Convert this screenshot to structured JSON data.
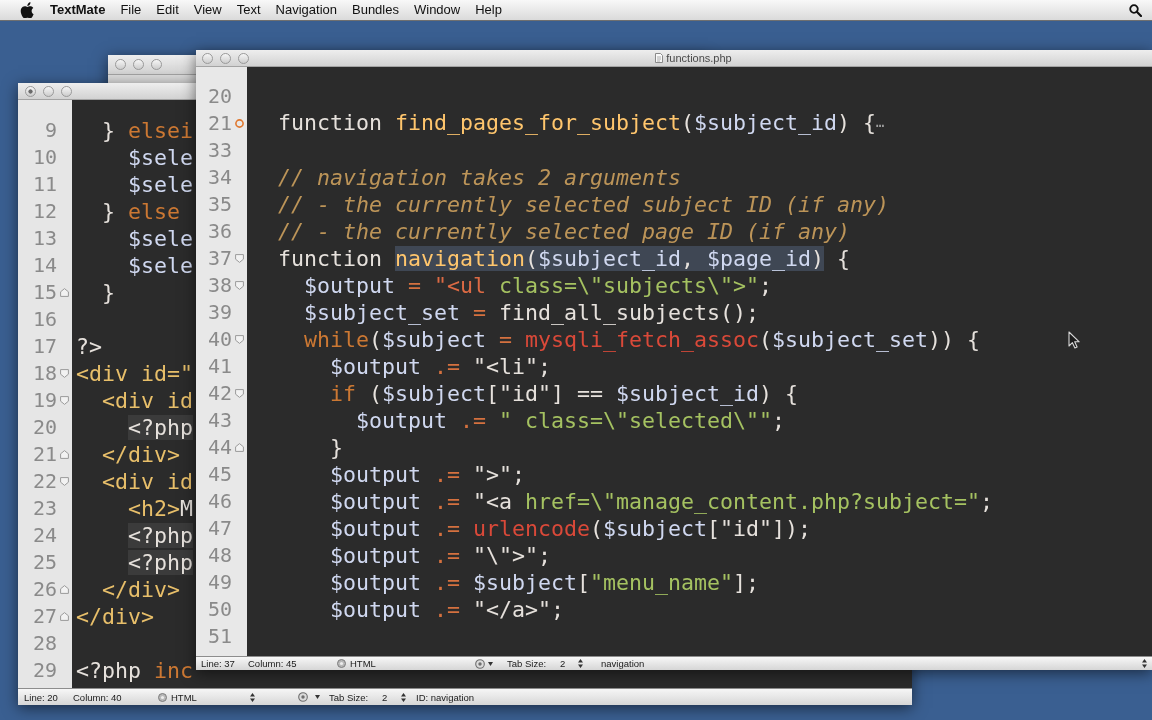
{
  "menu_bar": {
    "app_name": "TextMate",
    "menus": [
      "File",
      "Edit",
      "View",
      "Text",
      "Navigation",
      "Bundles",
      "Window",
      "Help"
    ]
  },
  "front_window": {
    "title": "functions.php",
    "unsaved": false,
    "lines": [
      {
        "number": "20",
        "kind": "code"
      },
      {
        "number": "21",
        "kind": "folded",
        "tokens": [
          {
            "kind": "plain",
            "text": "function "
          },
          {
            "kind": "entity",
            "text": "find_pages_for_subject"
          },
          {
            "kind": "plain",
            "text": "("
          },
          {
            "kind": "variable",
            "text": "$subject_id"
          },
          {
            "kind": "plain",
            "text": ") {"
          },
          {
            "kind": "fold-placeholder",
            "text": "⋯"
          }
        ]
      },
      {
        "number": "33",
        "kind": "code"
      },
      {
        "number": "34",
        "kind": "code",
        "tokens": [
          {
            "kind": "comment",
            "text": "// navigation takes 2 arguments"
          }
        ]
      },
      {
        "number": "35",
        "kind": "code",
        "tokens": [
          {
            "kind": "comment",
            "text": "// - the currently selected subject ID (if any)"
          }
        ]
      },
      {
        "number": "36",
        "kind": "code",
        "tokens": [
          {
            "kind": "comment",
            "text": "// - the currently selected page ID (if any)"
          }
        ]
      },
      {
        "number": "37",
        "kind": "fold-start",
        "tokens": [
          {
            "kind": "plain",
            "text": "function "
          },
          {
            "kind": "selection",
            "tokens": [
              {
                "kind": "entity",
                "text": "navigation"
              },
              {
                "kind": "plain",
                "text": "("
              },
              {
                "kind": "variable",
                "text": "$subject_id"
              },
              {
                "kind": "plain",
                "text": ", "
              },
              {
                "kind": "variable",
                "text": "$page_id"
              },
              {
                "kind": "plain",
                "text": ")"
              }
            ]
          },
          {
            "kind": "plain",
            "text": " {"
          }
        ],
        "children": [
          {
            "number": "38",
            "kind": "fold-start",
            "tokens": [
              {
                "kind": "variable",
                "text": "$output"
              },
              {
                "kind": "operator",
                "text": " = "
              },
              {
                "kind": "markup",
                "text": "\"<ul"
              },
              {
                "kind": "string",
                "text": " class=\\\"subjects\\\">\""
              },
              {
                "kind": "plain",
                "text": ";"
              }
            ]
          },
          {
            "number": "39",
            "kind": "code",
            "tokens": [
              {
                "kind": "variable",
                "text": "$subject_set"
              },
              {
                "kind": "operator",
                "text": " = "
              },
              {
                "kind": "plain",
                "text": "find_all_subjects();"
              }
            ]
          },
          {
            "number": "40",
            "kind": "fold-start",
            "tokens": [
              {
                "kind": "keyword",
                "text": "while"
              },
              {
                "kind": "plain",
                "text": "("
              },
              {
                "kind": "variable",
                "text": "$subject"
              },
              {
                "kind": "operator",
                "text": " = "
              },
              {
                "kind": "builtin",
                "text": "mysqli_fetch_assoc"
              },
              {
                "kind": "plain",
                "text": "("
              },
              {
                "kind": "variable",
                "text": "$subject_set"
              },
              {
                "kind": "plain",
                "text": ")) {"
              }
            ],
            "children": [
              {
                "number": "41",
                "kind": "code",
                "tokens": [
                  {
                    "kind": "variable",
                    "text": "$output"
                  },
                  {
                    "kind": "operator",
                    "text": " .= "
                  },
                  {
                    "kind": "plain",
                    "text": "\"<li\";"
                  }
                ]
              },
              {
                "number": "42",
                "kind": "fold-start",
                "tokens": [
                  {
                    "kind": "keyword",
                    "text": "if"
                  },
                  {
                    "kind": "plain",
                    "text": " ("
                  },
                  {
                    "kind": "variable",
                    "text": "$subject"
                  },
                  {
                    "kind": "plain",
                    "text": "[\"id\"] == "
                  },
                  {
                    "kind": "variable",
                    "text": "$subject_id"
                  },
                  {
                    "kind": "plain",
                    "text": ") {"
                  }
                ],
                "children": [
                  {
                    "number": "43",
                    "kind": "code",
                    "tokens": [
                      {
                        "kind": "variable",
                        "text": "$output"
                      },
                      {
                        "kind": "operator",
                        "text": " .= "
                      },
                      {
                        "kind": "string",
                        "text": "\" class=\\\"selected\\\"\""
                      },
                      {
                        "kind": "plain",
                        "text": ";"
                      }
                    ]
                  }
                ]
              },
              {
                "number": "44",
                "kind": "fold-end",
                "tokens": [
                  {
                    "kind": "plain",
                    "text": "}"
                  }
                ]
              },
              {
                "number": "45",
                "kind": "code",
                "tokens": [
                  {
                    "kind": "variable",
                    "text": "$output"
                  },
                  {
                    "kind": "operator",
                    "text": " .= "
                  },
                  {
                    "kind": "plain",
                    "text": "\">\";"
                  }
                ]
              },
              {
                "number": "46",
                "kind": "code",
                "tokens": [
                  {
                    "kind": "variable",
                    "text": "$output"
                  },
                  {
                    "kind": "operator",
                    "text": " .= "
                  },
                  {
                    "kind": "plain",
                    "text": "\"<a"
                  },
                  {
                    "kind": "string",
                    "text": " href=\\\"manage_content.php?subject=\""
                  },
                  {
                    "kind": "plain",
                    "text": ";"
                  }
                ]
              },
              {
                "number": "47",
                "kind": "code",
                "tokens": [
                  {
                    "kind": "variable",
                    "text": "$output"
                  },
                  {
                    "kind": "operator",
                    "text": " .= "
                  },
                  {
                    "kind": "builtin",
                    "text": "urlencode"
                  },
                  {
                    "kind": "plain",
                    "text": "("
                  },
                  {
                    "kind": "variable",
                    "text": "$subject"
                  },
                  {
                    "kind": "plain",
                    "text": "[\"id\"]);"
                  }
                ]
              },
              {
                "number": "48",
                "kind": "code",
                "tokens": [
                  {
                    "kind": "variable",
                    "text": "$output"
                  },
                  {
                    "kind": "operator",
                    "text": " .= "
                  },
                  {
                    "kind": "plain",
                    "text": "\"\\\">\";"
                  }
                ]
              },
              {
                "number": "49",
                "kind": "code",
                "tokens": [
                  {
                    "kind": "variable",
                    "text": "$output"
                  },
                  {
                    "kind": "operator",
                    "text": " .= "
                  },
                  {
                    "kind": "variable",
                    "text": "$subject"
                  },
                  {
                    "kind": "plain",
                    "text": "["
                  },
                  {
                    "kind": "string",
                    "text": "\"menu_name\""
                  },
                  {
                    "kind": "plain",
                    "text": "];"
                  }
                ]
              },
              {
                "number": "50",
                "kind": "code",
                "tokens": [
                  {
                    "kind": "variable",
                    "text": "$output"
                  },
                  {
                    "kind": "operator",
                    "text": " .= "
                  },
                  {
                    "kind": "plain",
                    "text": "\"</a>\";"
                  }
                ]
              },
              {
                "number": "51",
                "kind": "code"
              }
            ]
          }
        ]
      }
    ],
    "status_bar": {
      "line": "Line: 37",
      "column": "Column: 45",
      "language": "HTML",
      "tab_size_label": "Tab Size:",
      "tab_size": "2",
      "symbol": "navigation"
    }
  },
  "left_window": {
    "unsaved": true,
    "lines": [
      {
        "children": [
          {
            "number": "9",
            "kind": "code",
            "tokens": [
              {
                "kind": "plain",
                "text": "} "
              },
              {
                "kind": "keyword",
                "text": "elsei"
              }
            ],
            "children": [
              {
                "number": "10",
                "kind": "code",
                "tokens": [
                  {
                    "kind": "variable",
                    "text": "$sele"
                  }
                ]
              },
              {
                "number": "11",
                "kind": "code",
                "tokens": [
                  {
                    "kind": "variable",
                    "text": "$sele"
                  }
                ]
              }
            ]
          },
          {
            "number": "12",
            "kind": "code",
            "tokens": [
              {
                "kind": "plain",
                "text": "} "
              },
              {
                "kind": "keyword",
                "text": "else"
              }
            ],
            "children": [
              {
                "number": "13",
                "kind": "code",
                "tokens": [
                  {
                    "kind": "variable",
                    "text": "$sele"
                  }
                ]
              },
              {
                "number": "14",
                "kind": "code",
                "tokens": [
                  {
                    "kind": "variable",
                    "text": "$sele"
                  }
                ]
              }
            ]
          },
          {
            "number": "15",
            "kind": "fold-end",
            "tokens": [
              {
                "kind": "plain",
                "text": "}"
              }
            ]
          }
        ]
      },
      {
        "number": "16",
        "kind": "code"
      },
      {
        "number": "17",
        "kind": "code",
        "tokens": [
          {
            "kind": "plain",
            "text": "?>"
          }
        ]
      },
      {
        "number": "18",
        "kind": "fold-start",
        "tokens": [
          {
            "kind": "tag",
            "text": "<div id=\""
          }
        ],
        "children": [
          {
            "number": "19",
            "kind": "fold-start",
            "tokens": [
              {
                "kind": "tag",
                "text": "<div id"
              }
            ],
            "children": [
              {
                "number": "20",
                "kind": "code",
                "tokens": [
                  {
                    "kind": "embedded",
                    "text": "<?php"
                  }
                ]
              }
            ]
          },
          {
            "number": "21",
            "kind": "fold-end",
            "tokens": [
              {
                "kind": "tag",
                "text": "</div>"
              }
            ]
          },
          {
            "number": "22",
            "kind": "fold-start",
            "tokens": [
              {
                "kind": "tag",
                "text": "<div id"
              }
            ],
            "children": [
              {
                "number": "23",
                "kind": "code",
                "tokens": [
                  {
                    "kind": "tag",
                    "text": "<h2>"
                  },
                  {
                    "kind": "plain",
                    "text": "M"
                  }
                ]
              },
              {
                "number": "24",
                "kind": "code",
                "tokens": [
                  {
                    "kind": "embedded",
                    "text": "<?php"
                  }
                ]
              },
              {
                "number": "25",
                "kind": "code",
                "tokens": [
                  {
                    "kind": "embedded",
                    "text": "<?php"
                  }
                ]
              }
            ]
          },
          {
            "number": "26",
            "kind": "fold-end",
            "tokens": [
              {
                "kind": "tag",
                "text": "</div>"
              }
            ]
          }
        ]
      },
      {
        "number": "27",
        "kind": "fold-end",
        "tokens": [
          {
            "kind": "tag",
            "text": "</div>"
          }
        ]
      },
      {
        "number": "28",
        "kind": "code"
      },
      {
        "number": "29",
        "kind": "code",
        "tokens": [
          {
            "kind": "plain",
            "text": "<?php "
          },
          {
            "kind": "keyword",
            "text": "inc"
          }
        ]
      }
    ],
    "status_bar": {
      "line": "Line: 20",
      "column": "Column: 40",
      "language": "HTML",
      "tab_size_label": "Tab Size:",
      "tab_size": "2",
      "symbol": "ID: navigation"
    }
  }
}
